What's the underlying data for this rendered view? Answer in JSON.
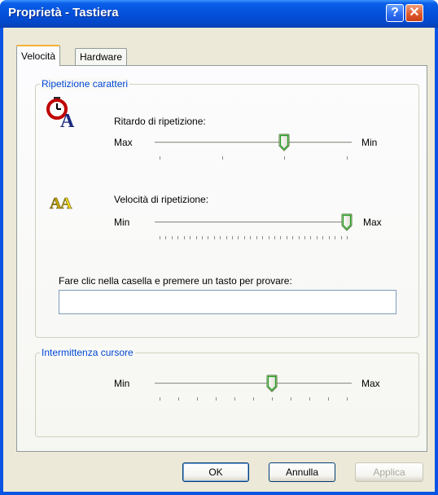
{
  "window": {
    "title": "Proprietà - Tastiera",
    "help_label": "?",
    "close_label": "✕"
  },
  "tabs": [
    {
      "label": "Velocità",
      "active": true
    },
    {
      "label": "Hardware",
      "active": false
    }
  ],
  "repeat_group": {
    "legend": "Ripetizione caratteri",
    "delay": {
      "label": "Ritardo di ripetizione:",
      "min_label": "Max",
      "max_label": "Min",
      "value": 2,
      "max": 3,
      "icon": "stopwatch-letter-a-icon"
    },
    "rate": {
      "label": "Velocità di ripetizione:",
      "min_label": "Min",
      "max_label": "Max",
      "value": 31,
      "max": 31,
      "icon": "double-letter-a-icon"
    },
    "test": {
      "label": "Fare clic nella casella e premere un tasto per provare:",
      "value": ""
    }
  },
  "cursor_group": {
    "legend": "Intermittenza cursore",
    "blink": {
      "min_label": "Min",
      "max_label": "Max",
      "value": 6,
      "max": 10
    }
  },
  "buttons": {
    "ok": "OK",
    "cancel": "Annulla",
    "apply": "Applica"
  },
  "colors": {
    "titlebar": "#0550da",
    "legend": "#0046d5",
    "tab_highlight": "#f5b23c",
    "face": "#ece9d8"
  }
}
